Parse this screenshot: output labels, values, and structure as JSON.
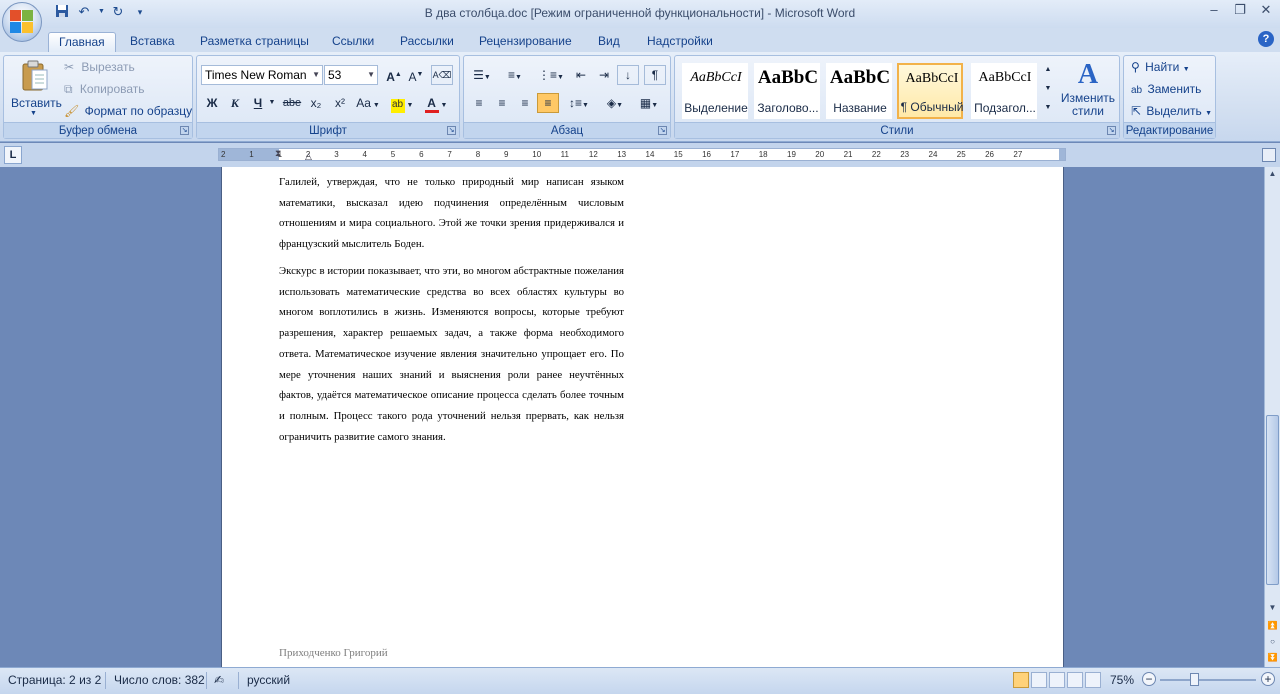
{
  "window": {
    "title": "В два столбца.doc [Режим ограниченной функциональности] - Microsoft Word"
  },
  "tabs": [
    {
      "label": "Главная",
      "active": true
    },
    {
      "label": "Вставка"
    },
    {
      "label": "Разметка страницы"
    },
    {
      "label": "Ссылки"
    },
    {
      "label": "Рассылки"
    },
    {
      "label": "Рецензирование"
    },
    {
      "label": "Вид"
    },
    {
      "label": "Надстройки"
    }
  ],
  "clipboard": {
    "paste": "Вставить",
    "cut": "Вырезать",
    "copy": "Копировать",
    "format_painter": "Формат по образцу",
    "label": "Буфер обмена"
  },
  "font": {
    "name": "Times New Roman",
    "size": "53",
    "label": "Шрифт",
    "bold": "Ж",
    "italic": "К",
    "underline": "Ч",
    "strike": "abe",
    "sub": "x₂",
    "sup": "x²",
    "case": "Aa"
  },
  "paragraph": {
    "label": "Абзац"
  },
  "styles": {
    "label": "Стили",
    "items": [
      {
        "sample": "AaBbCcI",
        "name": "Выделение"
      },
      {
        "sample": "AaBbC",
        "name": "Заголово..."
      },
      {
        "sample": "AaBbC",
        "name": "Название"
      },
      {
        "sample": "AaBbCcI",
        "name": "¶ Обычный",
        "selected": true
      },
      {
        "sample": "AaBbCcI",
        "name": "Подзагол..."
      }
    ],
    "change_styles": "Изменить стили"
  },
  "editing": {
    "label": "Редактирование",
    "find": "Найти",
    "replace": "Заменить",
    "select": "Выделить"
  },
  "ruler": {
    "numbers": [
      "2",
      "1",
      "1",
      "2",
      "3",
      "4",
      "5",
      "6",
      "7",
      "8",
      "9",
      "10",
      "11",
      "12",
      "13",
      "14",
      "15",
      "16",
      "17",
      "18",
      "19",
      "20",
      "21",
      "22",
      "23",
      "24",
      "25",
      "26",
      "27"
    ]
  },
  "document": {
    "paragraphs": [
      "Галилей, утверждая, что не только природный мир написан языком математики, высказал идею подчинения определённым числовым отношениям и мира социального. Этой же точки зрения придерживался и французский мыслитель Боден.",
      "Экскурс в истории показывает, что эти, во многом абстрактные пожелания использовать математические средства во всех областях культуры во многом воплотились в жизнь. Изменяются вопросы, которые требуют разрешения, характер решаемых задач, а также форма необходимого ответа. Математическое изучение явления значительно упрощает его. По мере уточнения наших знаний и выяснения роли ранее неучтённых фактов, удаётся математическое описание процесса сделать более точным и полным. Процесс такого рода уточнений нельзя прервать, как нельзя ограничить развитие самого знания."
    ],
    "footer": "Приходченко Григорий"
  },
  "status": {
    "page": "Страница: 2 из 2",
    "words": "Число слов: 382",
    "language": "русский",
    "zoom": "75%"
  }
}
